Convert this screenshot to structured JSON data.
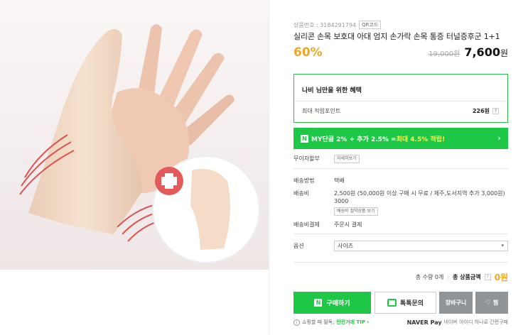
{
  "product": {
    "number_label": "상품번호 : 3184291794",
    "qr_label": "QR코드",
    "title": "실리콘 손목 보호대 아대 엄지 손가락 손목 통증 터널증후군 1+1",
    "discount": "60%",
    "original_price": "19,000원",
    "sale_price": "7,600",
    "sale_currency": "원"
  },
  "benefit": {
    "title": "나비 님만을 위한 혜택",
    "point_label": "최대 적립포인트",
    "point_value": "226원",
    "help_mark": "?"
  },
  "my_banner": {
    "badge": "N",
    "text_prefix": "MY단골 2% + 추가 2.5% = ",
    "highlight": "최대 4.5% 적립!",
    "chevron": "›"
  },
  "rows": {
    "installment_label": "무이자할부",
    "installment_button": "자세히보기",
    "shipping_method_label": "배송방법",
    "shipping_method_value": "택배",
    "shipping_fee_label": "배송비",
    "shipping_fee_value": "2,500원 (50,000원 이상 구매 시 무료 / 제주,도서지역 추가 3,000원)",
    "shipping_fee_extra": "3000",
    "shipping_fee_button": "배송비 절약상품 보기",
    "shipping_pay_label": "배송비결제",
    "shipping_pay_value": "주문시 결제",
    "option_label": "옵션",
    "option_selected": "사이즈",
    "option_caret": "▾"
  },
  "total": {
    "qty_text": "총 수량 0개",
    "sep": "|",
    "price_label": "총 상품금액",
    "help_mark": "?",
    "price": "0원"
  },
  "buttons": {
    "buy_badge": "N",
    "buy": "구매하기",
    "talk": "톡톡문의",
    "cart": "장바구니",
    "wish_heart": "♡",
    "wish": "찜"
  },
  "footer": {
    "info_mark": "i",
    "notice_prefix": "쇼핑할 때 필독,",
    "notice_tip": "안전거래 TIP ›",
    "npay_brand": "NAVER",
    "npay_pay": "Pay",
    "npay_text": "네이버 아이디 하나로 간편구매"
  },
  "colors": {
    "accent_green": "#1ec846",
    "discount_orange": "#f0a623",
    "highlight_yellow": "#fff34d"
  }
}
